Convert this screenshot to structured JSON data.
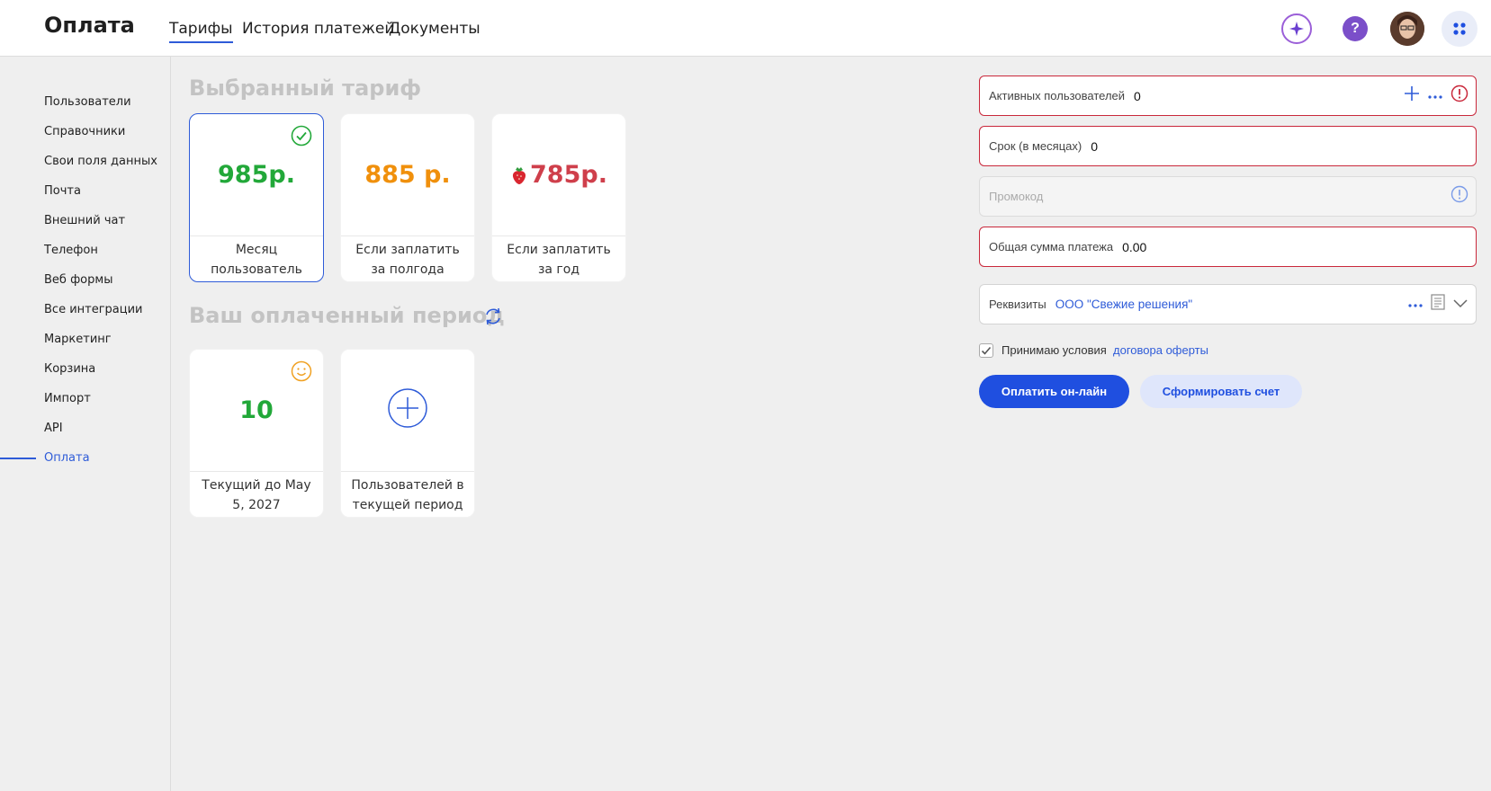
{
  "header": {
    "title": "Оплата",
    "tabs": [
      {
        "label": "Тарифы",
        "active": true
      },
      {
        "label": "История платежей",
        "active": false
      },
      {
        "label": "Документы",
        "active": false
      }
    ],
    "icons": {
      "assistant": "sparkle-icon",
      "help": "question-icon",
      "avatar": "avatar",
      "apps": "grid-icon"
    },
    "help_glyph": "?"
  },
  "sidebar": {
    "items": [
      {
        "label": "Пользователи"
      },
      {
        "label": "Справочники"
      },
      {
        "label": "Свои поля данных"
      },
      {
        "label": "Почта"
      },
      {
        "label": "Внешний чат"
      },
      {
        "label": "Телефон"
      },
      {
        "label": "Веб формы"
      },
      {
        "label": "Все интеграции"
      },
      {
        "label": "Маркетинг"
      },
      {
        "label": "Корзина"
      },
      {
        "label": "Импорт"
      },
      {
        "label": "API"
      },
      {
        "label": "Оплата",
        "active": true
      }
    ]
  },
  "tariff": {
    "title": "Выбранный тариф",
    "cards": [
      {
        "price": "985р.",
        "caption": "Месяц пользователь",
        "color": "#22a839",
        "selected": true
      },
      {
        "price": "885 р.",
        "caption": "Если заплатить за полгода",
        "color": "#f0900c",
        "selected": false
      },
      {
        "price": "785р.",
        "caption": "Если заплатить за год",
        "color": "#cf3f4b",
        "selected": false
      }
    ]
  },
  "period": {
    "title": "Ваш оплаченный период",
    "cards": [
      {
        "value": "10",
        "caption": "Текущий до May 5, 2027",
        "color": "#22a839"
      },
      {
        "caption": "Пользователей в текущей период"
      }
    ]
  },
  "form": {
    "active_users": {
      "label": "Активных пользователей",
      "value": "0"
    },
    "term": {
      "label": "Срок (в месяцах)",
      "value": "0"
    },
    "promo": {
      "placeholder": "Промокод"
    },
    "total": {
      "label": "Общая сумма платежа",
      "value": "0.00"
    },
    "requisites": {
      "label": "Реквизиты",
      "value": "ООО \"Свежие решения\""
    },
    "terms": {
      "text": "Принимаю условия",
      "link": "договора оферты",
      "checked": true
    },
    "pay_button": "Оплатить он-лайн",
    "invoice_button": "Сформировать счет"
  },
  "colors": {
    "accent": "#2e5bd8",
    "error_border": "#c9283b",
    "primary_button": "#1f4fe0"
  }
}
